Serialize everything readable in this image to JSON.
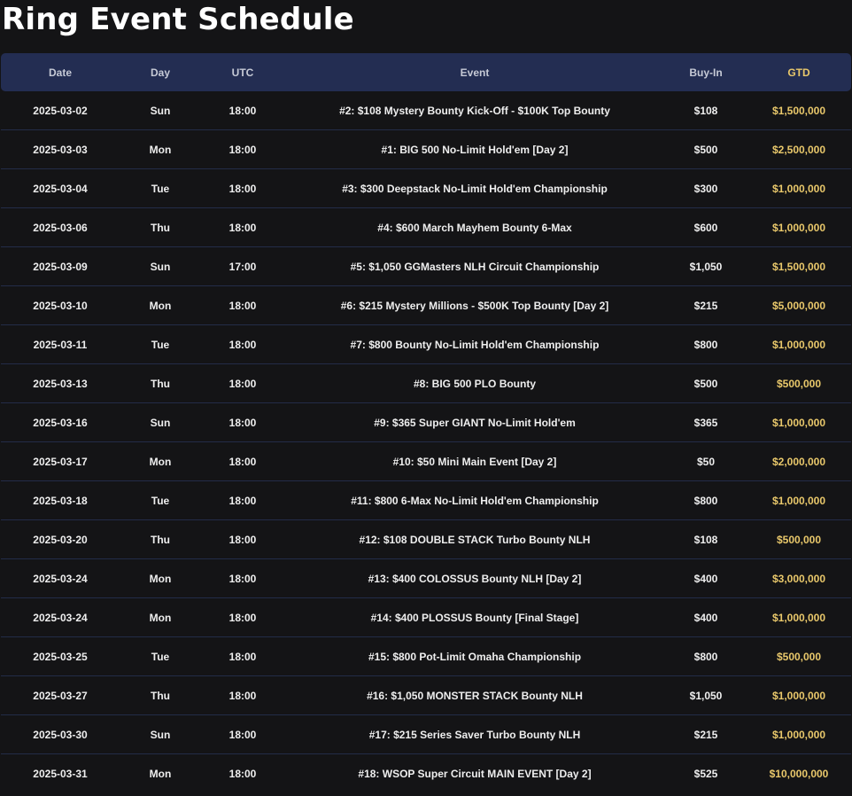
{
  "page": {
    "title": "Ring Event Schedule"
  },
  "table": {
    "headers": {
      "date": "Date",
      "day": "Day",
      "utc": "UTC",
      "event": "Event",
      "buyin": "Buy-In",
      "gtd": "GTD"
    },
    "rows": [
      {
        "date": "2025-03-02",
        "day": "Sun",
        "utc": "18:00",
        "event": "#2: $108 Mystery Bounty Kick-Off - $100K Top Bounty",
        "buyin": "$108",
        "gtd": "$1,500,000"
      },
      {
        "date": "2025-03-03",
        "day": "Mon",
        "utc": "18:00",
        "event": "#1: BIG 500 No-Limit Hold'em [Day 2]",
        "buyin": "$500",
        "gtd": "$2,500,000"
      },
      {
        "date": "2025-03-04",
        "day": "Tue",
        "utc": "18:00",
        "event": "#3: $300 Deepstack No-Limit Hold'em Championship",
        "buyin": "$300",
        "gtd": "$1,000,000"
      },
      {
        "date": "2025-03-06",
        "day": "Thu",
        "utc": "18:00",
        "event": "#4: $600 March Mayhem Bounty 6-Max",
        "buyin": "$600",
        "gtd": "$1,000,000"
      },
      {
        "date": "2025-03-09",
        "day": "Sun",
        "utc": "17:00",
        "event": "#5: $1,050 GGMasters NLH Circuit Championship",
        "buyin": "$1,050",
        "gtd": "$1,500,000"
      },
      {
        "date": "2025-03-10",
        "day": "Mon",
        "utc": "18:00",
        "event": "#6: $215 Mystery Millions - $500K Top Bounty [Day 2]",
        "buyin": "$215",
        "gtd": "$5,000,000"
      },
      {
        "date": "2025-03-11",
        "day": "Tue",
        "utc": "18:00",
        "event": "#7: $800 Bounty No-Limit Hold'em Championship",
        "buyin": "$800",
        "gtd": "$1,000,000"
      },
      {
        "date": "2025-03-13",
        "day": "Thu",
        "utc": "18:00",
        "event": "#8: BIG 500 PLO Bounty",
        "buyin": "$500",
        "gtd": "$500,000"
      },
      {
        "date": "2025-03-16",
        "day": "Sun",
        "utc": "18:00",
        "event": "#9: $365 Super GIANT No-Limit Hold'em",
        "buyin": "$365",
        "gtd": "$1,000,000"
      },
      {
        "date": "2025-03-17",
        "day": "Mon",
        "utc": "18:00",
        "event": "#10: $50 Mini Main Event [Day 2]",
        "buyin": "$50",
        "gtd": "$2,000,000"
      },
      {
        "date": "2025-03-18",
        "day": "Tue",
        "utc": "18:00",
        "event": "#11: $800 6-Max No-Limit Hold'em Championship",
        "buyin": "$800",
        "gtd": "$1,000,000"
      },
      {
        "date": "2025-03-20",
        "day": "Thu",
        "utc": "18:00",
        "event": "#12: $108 DOUBLE STACK Turbo Bounty NLH",
        "buyin": "$108",
        "gtd": "$500,000"
      },
      {
        "date": "2025-03-24",
        "day": "Mon",
        "utc": "18:00",
        "event": "#13: $400 COLOSSUS Bounty NLH [Day 2]",
        "buyin": "$400",
        "gtd": "$3,000,000"
      },
      {
        "date": "2025-03-24",
        "day": "Mon",
        "utc": "18:00",
        "event": "#14: $400 PLOSSUS Bounty [Final Stage]",
        "buyin": "$400",
        "gtd": "$1,000,000"
      },
      {
        "date": "2025-03-25",
        "day": "Tue",
        "utc": "18:00",
        "event": "#15: $800 Pot-Limit Omaha Championship",
        "buyin": "$800",
        "gtd": "$500,000"
      },
      {
        "date": "2025-03-27",
        "day": "Thu",
        "utc": "18:00",
        "event": "#16: $1,050 MONSTER STACK Bounty NLH",
        "buyin": "$1,050",
        "gtd": "$1,000,000"
      },
      {
        "date": "2025-03-30",
        "day": "Sun",
        "utc": "18:00",
        "event": "#17: $215 Series Saver Turbo Bounty NLH",
        "buyin": "$215",
        "gtd": "$1,000,000"
      },
      {
        "date": "2025-03-31",
        "day": "Mon",
        "utc": "18:00",
        "event": "#18: WSOP Super Circuit MAIN EVENT [Day 2]",
        "buyin": "$525",
        "gtd": "$10,000,000"
      }
    ]
  },
  "colors": {
    "background": "#141416",
    "header_bg": "#232d52",
    "gtd_accent": "#e9c86b"
  }
}
